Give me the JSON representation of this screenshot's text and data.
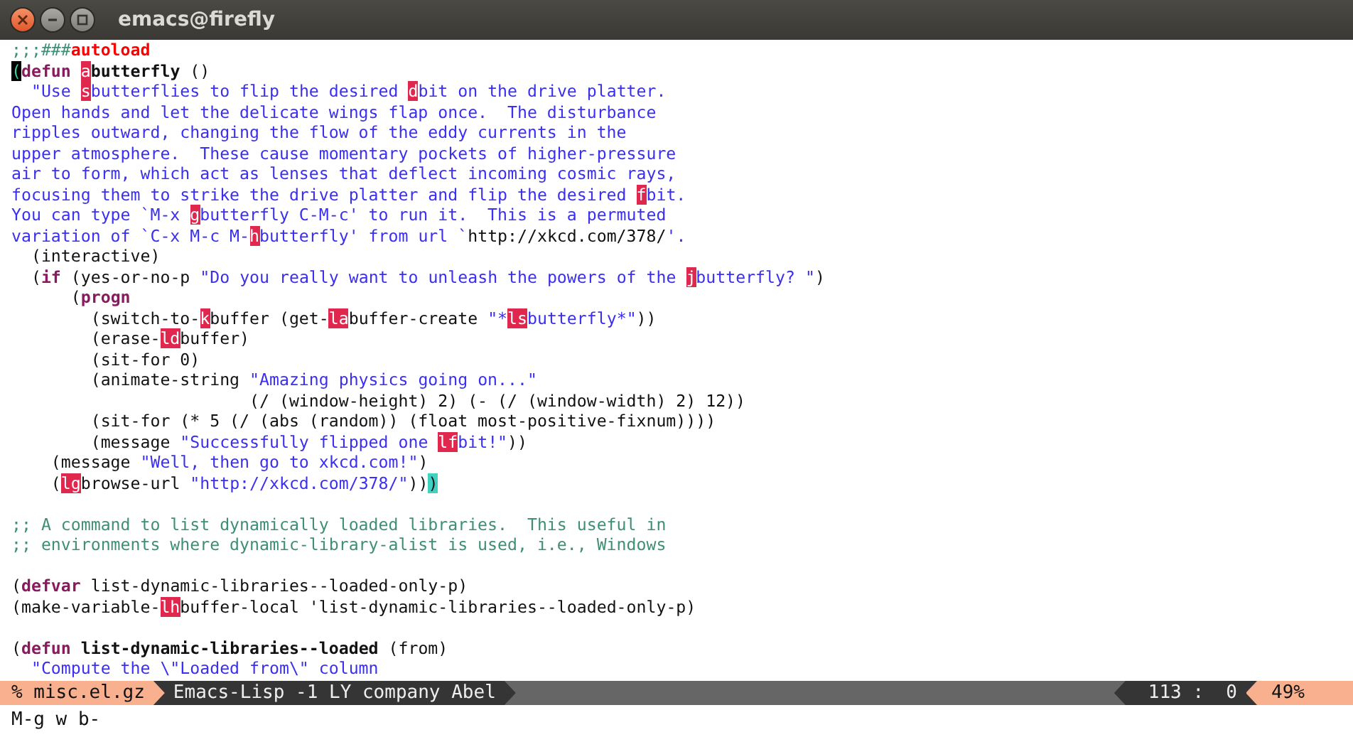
{
  "window": {
    "title": "emacs@firefly"
  },
  "lines": [
    {
      "segments": [
        {
          "kind": "comment",
          "text": ";;;###"
        },
        {
          "kind": "autoload",
          "text": "autoload"
        }
      ]
    },
    {
      "segments": [
        {
          "kind": "cursor",
          "text": "("
        },
        {
          "kind": "keyword",
          "text": "defun "
        },
        {
          "kind": "hint",
          "text": "a"
        },
        {
          "kind": "name",
          "text": "butterfly"
        },
        {
          "kind": "plain",
          "text": " ()"
        }
      ]
    },
    {
      "segments": [
        {
          "kind": "string",
          "text": "  \"Use "
        },
        {
          "kind": "hint",
          "text": "s"
        },
        {
          "kind": "string",
          "text": "butterflies to flip the desired "
        },
        {
          "kind": "hint",
          "text": "d"
        },
        {
          "kind": "string",
          "text": "bit on the drive platter."
        }
      ]
    },
    {
      "segments": [
        {
          "kind": "string",
          "text": "Open hands and let the delicate wings flap once.  The disturbance"
        }
      ]
    },
    {
      "segments": [
        {
          "kind": "string",
          "text": "ripples outward, changing the flow of the eddy currents in the"
        }
      ]
    },
    {
      "segments": [
        {
          "kind": "string",
          "text": "upper atmosphere.  These cause momentary pockets of higher-pressure"
        }
      ]
    },
    {
      "segments": [
        {
          "kind": "string",
          "text": "air to form, which act as lenses that deflect incoming cosmic rays,"
        }
      ]
    },
    {
      "segments": [
        {
          "kind": "string",
          "text": "focusing them to strike the drive platter and flip the desired "
        },
        {
          "kind": "hint",
          "text": "f"
        },
        {
          "kind": "string",
          "text": "bit."
        }
      ]
    },
    {
      "segments": [
        {
          "kind": "string",
          "text": "You can type `M-x "
        },
        {
          "kind": "hint",
          "text": "g"
        },
        {
          "kind": "string",
          "text": "butterfly C-M-c' to run it.  This is a permuted"
        }
      ]
    },
    {
      "segments": [
        {
          "kind": "string",
          "text": "variation of `C-x M-c M-"
        },
        {
          "kind": "hint",
          "text": "h"
        },
        {
          "kind": "string",
          "text": "butterfly' from url `"
        },
        {
          "kind": "plain",
          "text": "http://xkcd.com/378/"
        },
        {
          "kind": "string",
          "text": "'."
        }
      ]
    },
    {
      "segments": [
        {
          "kind": "plain",
          "text": "  (interactive)"
        }
      ]
    },
    {
      "segments": [
        {
          "kind": "plain",
          "text": "  ("
        },
        {
          "kind": "keyword",
          "text": "if"
        },
        {
          "kind": "plain",
          "text": " (yes-or-no-p "
        },
        {
          "kind": "string",
          "text": "\"Do you really want to unleash the powers of the "
        },
        {
          "kind": "hint",
          "text": "j"
        },
        {
          "kind": "string",
          "text": "butterfly? \""
        },
        {
          "kind": "plain",
          "text": ")"
        }
      ]
    },
    {
      "segments": [
        {
          "kind": "plain",
          "text": "      ("
        },
        {
          "kind": "keyword",
          "text": "progn"
        }
      ]
    },
    {
      "segments": [
        {
          "kind": "plain",
          "text": "        (switch-to-"
        },
        {
          "kind": "hint",
          "text": "k"
        },
        {
          "kind": "plain",
          "text": "buffer (get-"
        },
        {
          "kind": "hint",
          "text": "la"
        },
        {
          "kind": "plain",
          "text": "buffer-create "
        },
        {
          "kind": "string",
          "text": "\"*"
        },
        {
          "kind": "hint",
          "text": "ls"
        },
        {
          "kind": "string",
          "text": "butterfly*\""
        },
        {
          "kind": "plain",
          "text": "))"
        }
      ]
    },
    {
      "segments": [
        {
          "kind": "plain",
          "text": "        (erase-"
        },
        {
          "kind": "hint",
          "text": "ld"
        },
        {
          "kind": "plain",
          "text": "buffer)"
        }
      ]
    },
    {
      "segments": [
        {
          "kind": "plain",
          "text": "        (sit-for 0)"
        }
      ]
    },
    {
      "segments": [
        {
          "kind": "plain",
          "text": "        (animate-string "
        },
        {
          "kind": "string",
          "text": "\"Amazing physics going on...\""
        }
      ]
    },
    {
      "segments": [
        {
          "kind": "plain",
          "text": "                        (/ (window-height) 2) (- (/ (window-width) 2) 12))"
        }
      ]
    },
    {
      "segments": [
        {
          "kind": "plain",
          "text": "        (sit-for (* 5 (/ (abs (random)) (float most-positive-fixnum))))"
        }
      ]
    },
    {
      "segments": [
        {
          "kind": "plain",
          "text": "        (message "
        },
        {
          "kind": "string",
          "text": "\"Successfully flipped one "
        },
        {
          "kind": "hint",
          "text": "lf"
        },
        {
          "kind": "string",
          "text": "bit!\""
        },
        {
          "kind": "plain",
          "text": "))"
        }
      ]
    },
    {
      "segments": [
        {
          "kind": "plain",
          "text": "    (message "
        },
        {
          "kind": "string",
          "text": "\"Well, then go to xkcd.com!\""
        },
        {
          "kind": "plain",
          "text": ")"
        }
      ]
    },
    {
      "segments": [
        {
          "kind": "plain",
          "text": "    ("
        },
        {
          "kind": "hint",
          "text": "lg"
        },
        {
          "kind": "plain",
          "text": "browse-url "
        },
        {
          "kind": "string",
          "text": "\"http://xkcd.com/378/\""
        },
        {
          "kind": "plain",
          "text": "))"
        },
        {
          "kind": "match",
          "text": ")"
        }
      ]
    },
    {
      "blank_before": true,
      "segments": [
        {
          "kind": "comment",
          "text": ";; A command to list dynamically loaded libraries.  This useful in"
        }
      ]
    },
    {
      "segments": [
        {
          "kind": "comment",
          "text": ";; environments where dynamic-library-alist is used, i.e., Windows"
        }
      ]
    },
    {
      "blank_before": true,
      "segments": [
        {
          "kind": "plain",
          "text": "("
        },
        {
          "kind": "keyword",
          "text": "defvar"
        },
        {
          "kind": "plain",
          "text": " list-dynamic-libraries--loaded-only-p)"
        }
      ]
    },
    {
      "segments": [
        {
          "kind": "plain",
          "text": "(make-variable-"
        },
        {
          "kind": "hint",
          "text": "lh"
        },
        {
          "kind": "plain",
          "text": "buffer-local 'list-dynamic-libraries--loaded-only-p)"
        }
      ]
    },
    {
      "blank_before": true,
      "segments": [
        {
          "kind": "plain",
          "text": "("
        },
        {
          "kind": "keyword",
          "text": "defun "
        },
        {
          "kind": "name",
          "text": "list-dynamic-libraries--loaded"
        },
        {
          "kind": "plain",
          "text": " (from)"
        }
      ]
    },
    {
      "segments": [
        {
          "kind": "string",
          "text": "  \"Compute the \\\"Loaded from\\\" column"
        }
      ]
    }
  ],
  "mode_line": {
    "buffer": "% misc.el.gz",
    "modes": "Emacs-Lisp -1 LY company Abel",
    "position": "113 :  0",
    "percent": "49%"
  },
  "minibuffer": "M-g w b-"
}
